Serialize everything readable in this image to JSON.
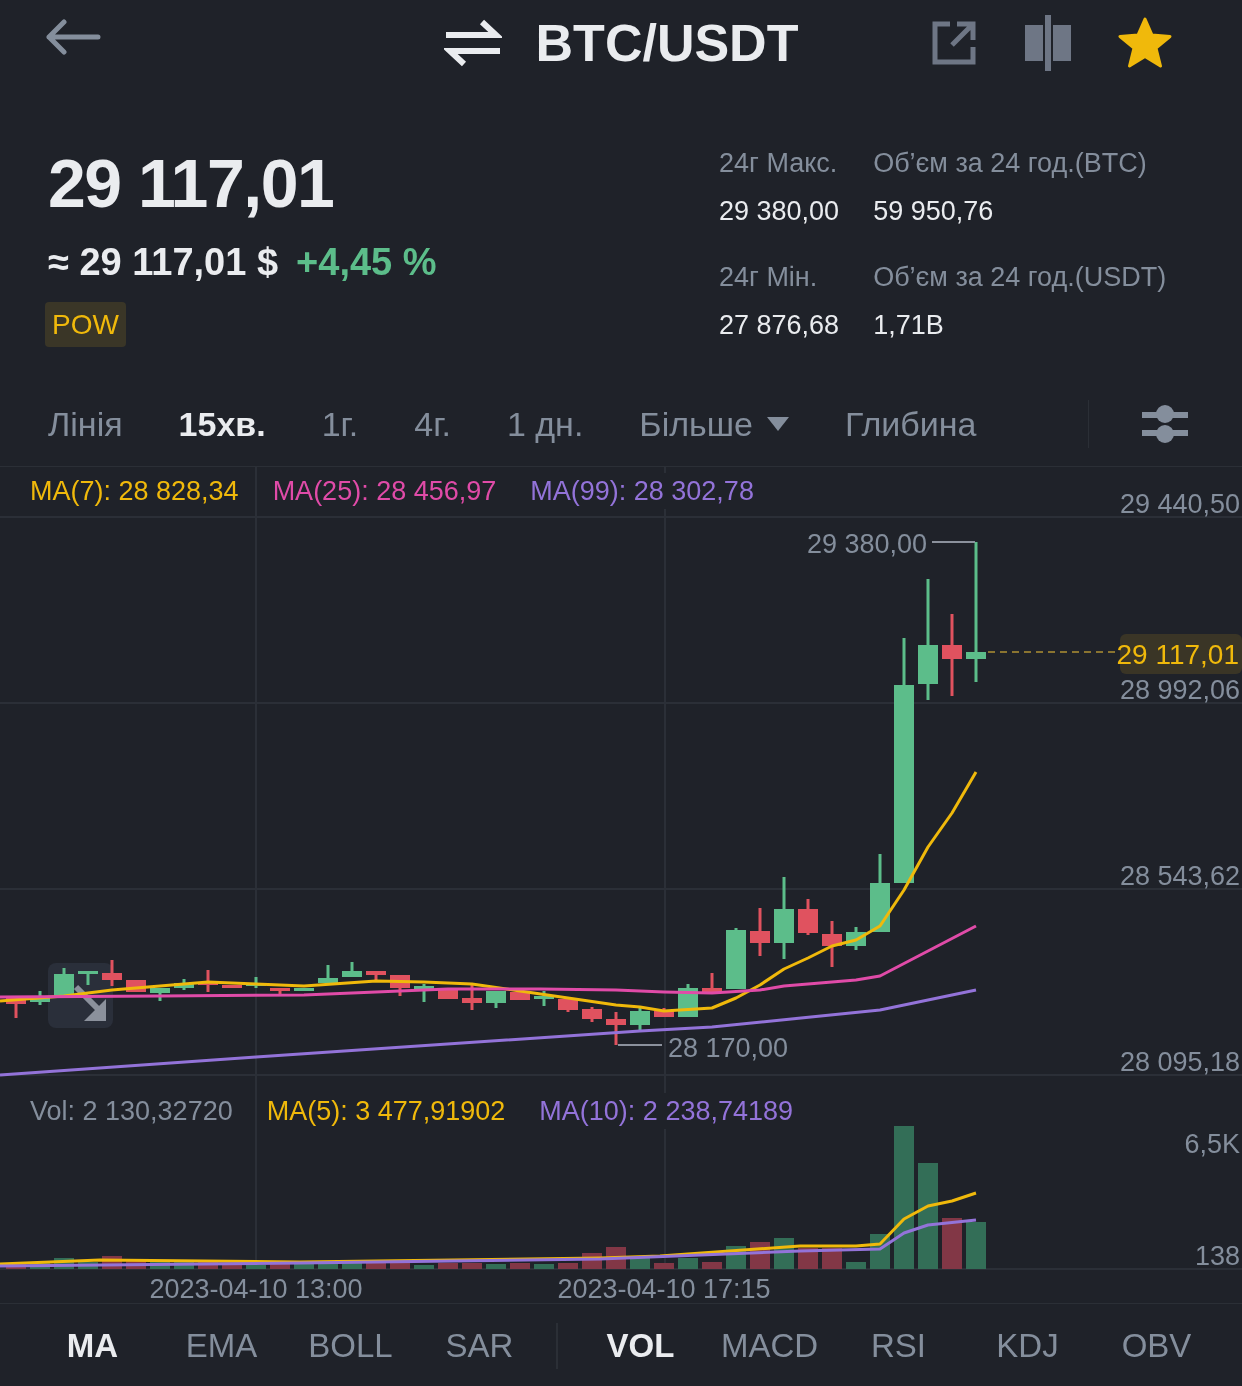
{
  "header": {
    "title": "BTC/USDT",
    "favorite": true
  },
  "summary": {
    "last_price": "29 117,01",
    "fiat_price": "≈ 29 117,01 $",
    "change": "+4,45 %",
    "tag": "POW"
  },
  "stats": [
    {
      "label": "24г Макс.",
      "value": "29 380,00"
    },
    {
      "label": "Об’єм за 24 год.(BTC)",
      "value": "59 950,76"
    },
    {
      "label": "24г Мін.",
      "value": "27 876,68"
    },
    {
      "label": "Об’єм за 24 год.(USDT)",
      "value": "1,71B"
    }
  ],
  "intervals": [
    {
      "label": "Лінія",
      "selected": false,
      "kind": "tab"
    },
    {
      "label": "15хв.",
      "selected": true,
      "kind": "tab"
    },
    {
      "label": "1г.",
      "selected": false,
      "kind": "tab"
    },
    {
      "label": "4г.",
      "selected": false,
      "kind": "tab"
    },
    {
      "label": "1 дн.",
      "selected": false,
      "kind": "tab"
    },
    {
      "label": "Більше",
      "selected": false,
      "kind": "dropdown"
    },
    {
      "label": "Глибина",
      "selected": false,
      "kind": "tab"
    }
  ],
  "chart": {
    "legend": [
      {
        "label": "MA(7): 28 828,34",
        "color": "#f0b90b"
      },
      {
        "label": "MA(25): 28 456,97",
        "color": "#e04ba8"
      },
      {
        "label": "MA(99): 28 302,78",
        "color": "#9373d9"
      }
    ],
    "price_axis": [
      "29 440,50",
      "28 992,06",
      "28 543,62",
      "28 095,18"
    ],
    "high_label": "29 380,00",
    "low_label": "28 170,00",
    "last_price": "29 117,01"
  },
  "volume": {
    "legend": [
      {
        "label": "Vol: 2 130,32720",
        "color": "#848e9c"
      },
      {
        "label": "MA(5): 3 477,91902",
        "color": "#f0b90b"
      },
      {
        "label": "MA(10): 2 238,74189",
        "color": "#9373d9"
      }
    ],
    "axis": [
      "6,5K",
      "138"
    ]
  },
  "time_axis": [
    "2023-04-10 13:00",
    "2023-04-10 17:15"
  ],
  "indicator_groups": [
    {
      "items": [
        {
          "label": "MA",
          "selected": true
        },
        {
          "label": "EMA",
          "selected": false
        },
        {
          "label": "BOLL",
          "selected": false
        },
        {
          "label": "SAR",
          "selected": false
        }
      ]
    },
    {
      "items": [
        {
          "label": "VOL",
          "selected": true
        },
        {
          "label": "MACD",
          "selected": false
        },
        {
          "label": "RSI",
          "selected": false
        },
        {
          "label": "KDJ",
          "selected": false
        },
        {
          "label": "OBV",
          "selected": false
        }
      ]
    }
  ]
}
